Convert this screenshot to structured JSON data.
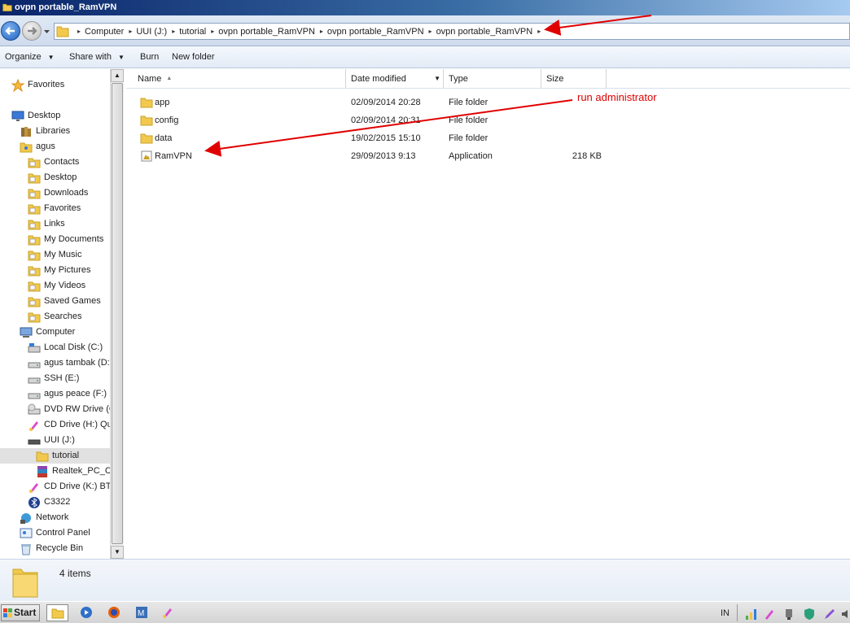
{
  "window": {
    "title": "ovpn portable_RamVPN"
  },
  "address": {
    "crumbs": [
      "Computer",
      "UUI (J:)",
      "tutorial",
      "ovpn portable_RamVPN",
      "ovpn portable_RamVPN",
      "ovpn portable_RamVPN"
    ]
  },
  "toolbar": {
    "organize": "Organize",
    "share_with": "Share with",
    "burn": "Burn",
    "new_folder": "New folder"
  },
  "nav": {
    "items": [
      {
        "label": "Favorites",
        "icon": "star-icon",
        "indent": 0
      },
      {
        "label": "Desktop",
        "icon": "desktop-icon",
        "indent": 0
      },
      {
        "label": "Libraries",
        "icon": "libraries-icon",
        "indent": 1
      },
      {
        "label": "agus",
        "icon": "user-folder-icon",
        "indent": 1
      },
      {
        "label": "Contacts",
        "icon": "contacts-folder-icon",
        "indent": 2
      },
      {
        "label": "Desktop",
        "icon": "desktop-folder-icon",
        "indent": 2
      },
      {
        "label": "Downloads",
        "icon": "downloads-folder-icon",
        "indent": 2
      },
      {
        "label": "Favorites",
        "icon": "favorites-folder-icon",
        "indent": 2
      },
      {
        "label": "Links",
        "icon": "links-folder-icon",
        "indent": 2
      },
      {
        "label": "My Documents",
        "icon": "documents-folder-icon",
        "indent": 2
      },
      {
        "label": "My Music",
        "icon": "music-folder-icon",
        "indent": 2
      },
      {
        "label": "My Pictures",
        "icon": "pictures-folder-icon",
        "indent": 2
      },
      {
        "label": "My Videos",
        "icon": "videos-folder-icon",
        "indent": 2
      },
      {
        "label": "Saved Games",
        "icon": "saved-games-folder-icon",
        "indent": 2
      },
      {
        "label": "Searches",
        "icon": "searches-folder-icon",
        "indent": 2
      },
      {
        "label": "Computer",
        "icon": "computer-icon",
        "indent": 1
      },
      {
        "label": "Local Disk (C:)",
        "icon": "local-disk-icon",
        "indent": 2
      },
      {
        "label": "agus tambak (D:)",
        "icon": "drive-icon",
        "indent": 2
      },
      {
        "label": "SSH (E:)",
        "icon": "drive-icon",
        "indent": 2
      },
      {
        "label": "agus peace (F:)",
        "icon": "drive-icon",
        "indent": 2
      },
      {
        "label": "DVD RW Drive (G:)",
        "icon": "dvd-drive-icon",
        "indent": 2
      },
      {
        "label": "CD Drive (H:) Qu",
        "icon": "cd-drive-icon",
        "indent": 2
      },
      {
        "label": "UUI (J:)",
        "icon": "usb-drive-icon",
        "indent": 2
      },
      {
        "label": "tutorial",
        "icon": "folder-icon",
        "indent": 3,
        "selected": true
      },
      {
        "label": "Realtek_PC_Ca",
        "icon": "winrar-archive-icon",
        "indent": 3
      },
      {
        "label": "CD Drive (K:) BT",
        "icon": "cd-drive-icon",
        "indent": 2
      },
      {
        "label": "C3322",
        "icon": "bluetooth-icon",
        "indent": 2
      },
      {
        "label": "Network",
        "icon": "network-icon",
        "indent": 1
      },
      {
        "label": "Control Panel",
        "icon": "control-panel-icon",
        "indent": 1
      },
      {
        "label": "Recycle Bin",
        "icon": "recycle-bin-icon",
        "indent": 1
      }
    ]
  },
  "filelist": {
    "columns": {
      "name": "Name",
      "date": "Date modified",
      "type": "Type",
      "size": "Size"
    },
    "rows": [
      {
        "name": "app",
        "date": "02/09/2014 20:28",
        "type": "File folder",
        "size": "",
        "icon": "folder-icon"
      },
      {
        "name": "config",
        "date": "02/09/2014 20:31",
        "type": "File folder",
        "size": "",
        "icon": "folder-icon"
      },
      {
        "name": "data",
        "date": "19/02/2015 15:10",
        "type": "File folder",
        "size": "",
        "icon": "folder-icon"
      },
      {
        "name": "RamVPN",
        "date": "29/09/2013 9:13",
        "type": "Application",
        "size": "218 KB",
        "icon": "application-icon"
      }
    ]
  },
  "annotation": {
    "text": "run administrator",
    "color": "#e00000"
  },
  "details": {
    "count": "4 items"
  },
  "taskbar": {
    "start": "Start",
    "lang": "IN"
  }
}
